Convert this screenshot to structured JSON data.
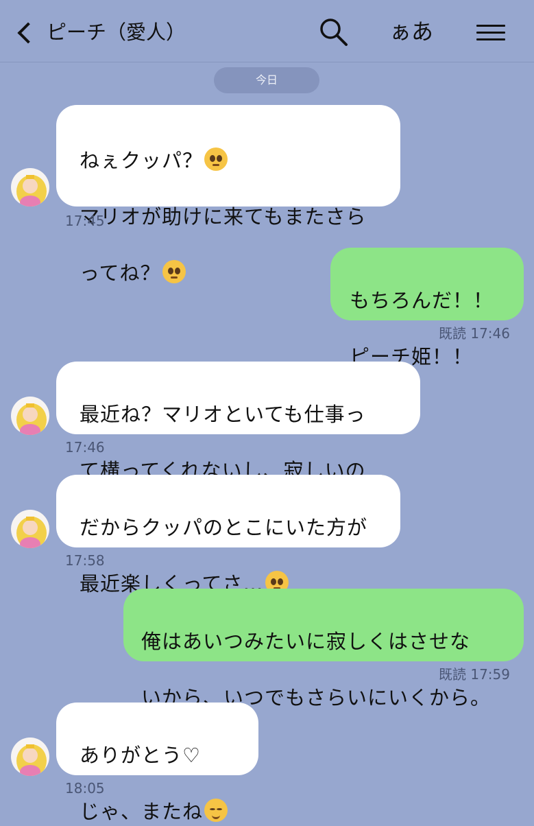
{
  "header": {
    "title": "ピーチ（愛人）",
    "font_size_label": "ぁあ"
  },
  "date_separator": "今日",
  "messages": [
    {
      "side": "in",
      "text": "ねぇクッパ？",
      "emoji1": "pleading-face-emoji",
      "line2": "マリオが助けに来てもまたさら",
      "line3": "ってね？",
      "time": "17:45"
    },
    {
      "side": "out",
      "line1": "もちろんだ！！",
      "line2": "ピーチ姫！！",
      "read": "既読",
      "time": "17:46"
    },
    {
      "side": "in",
      "line1": "最近ね？マリオといても仕事っ",
      "line2": "て構ってくれないし、寂しいの…",
      "time": "17:46"
    },
    {
      "side": "in",
      "line1": "だからクッパのとこにいた方が",
      "line2": "最近楽しくってさ…",
      "time": "17:58"
    },
    {
      "side": "out",
      "line1": "俺はあいつみたいに寂しくはさせな",
      "line2": "いから、いつでもさらいにいくから。",
      "read": "既読",
      "time": "17:59"
    },
    {
      "side": "in",
      "line1": "ありがとう♡",
      "line2": "じゃ、またね",
      "time": "18:05"
    }
  ],
  "icons": [
    "back-icon",
    "search-icon",
    "menu-icon",
    "avatar-peach",
    "pleading-face-emoji",
    "relieved-face-emoji"
  ]
}
